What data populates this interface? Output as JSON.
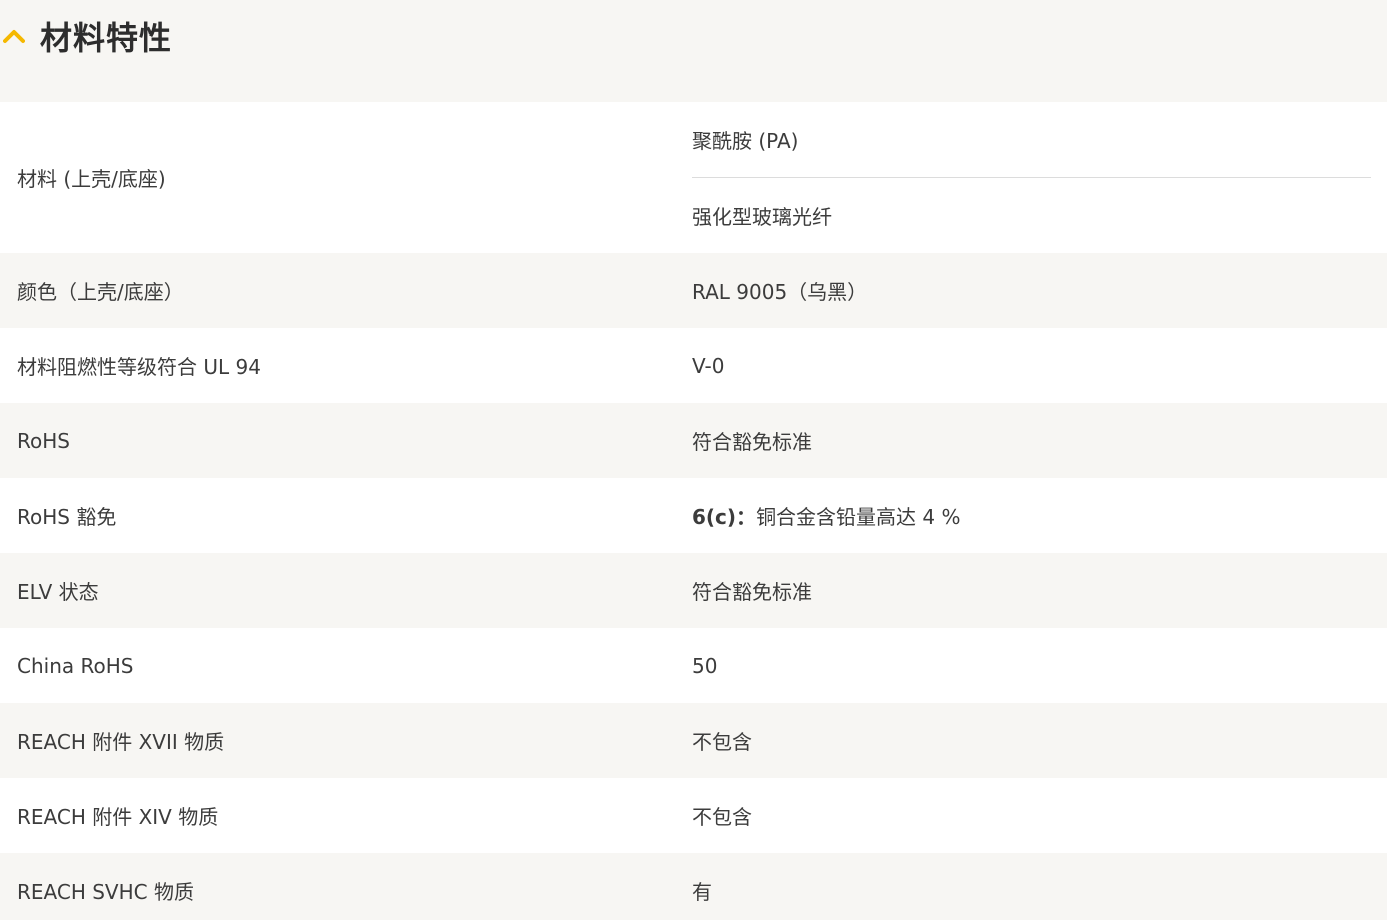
{
  "section": {
    "title": "材料特性",
    "icon": "chevron-up-icon",
    "accent_color": "#f5b800"
  },
  "rows": [
    {
      "label": "材料 (上壳/底座)",
      "values": [
        "聚酰胺 (PA)",
        "强化型玻璃光纤"
      ]
    },
    {
      "label": "颜色（上壳/底座）",
      "value": "RAL 9005（乌黑）"
    },
    {
      "label": "材料阻燃性等级符合 UL 94",
      "value": "V-0"
    },
    {
      "label": "RoHS",
      "value": "符合豁免标准"
    },
    {
      "label": "RoHS 豁免",
      "value_bold": "6(c)：",
      "value": "铜合金含铅量高达 4 %"
    },
    {
      "label": "ELV 状态",
      "value": "符合豁免标准"
    },
    {
      "label": "China RoHS",
      "value": "50"
    },
    {
      "label": "REACH 附件 XVII 物质",
      "value": "不包含"
    },
    {
      "label": "REACH 附件 XIV 物质",
      "value": "不包含"
    },
    {
      "label": "REACH SVHC 物质",
      "value": "有"
    }
  ]
}
